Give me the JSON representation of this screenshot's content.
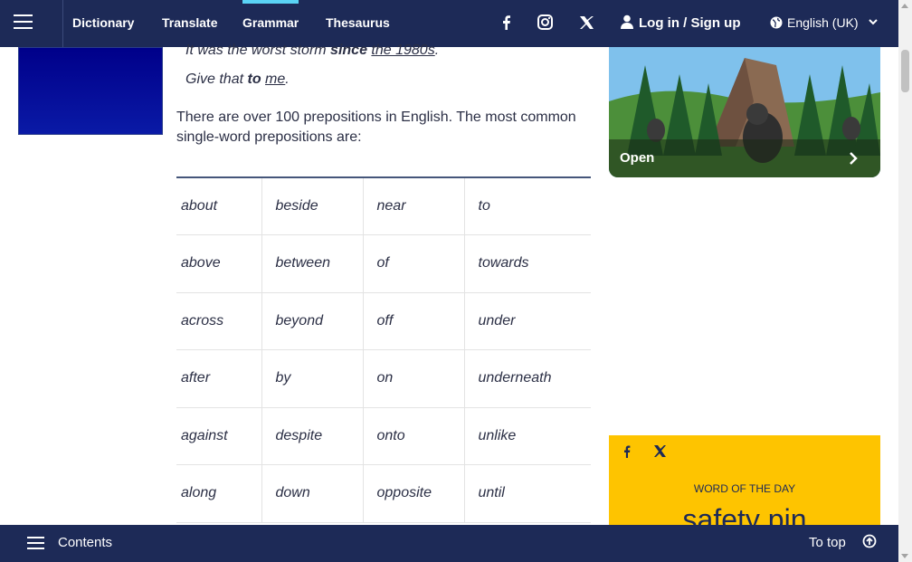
{
  "nav": {
    "links": [
      "Dictionary",
      "Translate",
      "Grammar",
      "Thesaurus"
    ],
    "active": "Grammar",
    "login_label": "Log in / Sign up",
    "language_label": "English (UK)"
  },
  "content": {
    "example1": {
      "pre": "It was the worst storm ",
      "bold": "since",
      "mid": " ",
      "link": "the 1980s",
      "post": "."
    },
    "example2": {
      "pre": "Give that ",
      "bold": "to",
      "mid": " ",
      "link": "me",
      "post": "."
    },
    "paragraph": "There are over 100 prepositions in English. The most common single-word prepositions are:"
  },
  "prepositions_table": [
    [
      "about",
      "beside",
      "near",
      "to"
    ],
    [
      "above",
      "between",
      "of",
      "towards"
    ],
    [
      "across",
      "beyond",
      "off",
      "under"
    ],
    [
      "after",
      "by",
      "on",
      "underneath"
    ],
    [
      "against",
      "despite",
      "onto",
      "unlike"
    ],
    [
      "along",
      "down",
      "opposite",
      "until"
    ]
  ],
  "ad": {
    "open_label": "Open"
  },
  "word_of_day": {
    "label": "WORD OF THE DAY",
    "word": "safety pin"
  },
  "bottom": {
    "contents_label": "Contents",
    "top_label": "To top"
  }
}
